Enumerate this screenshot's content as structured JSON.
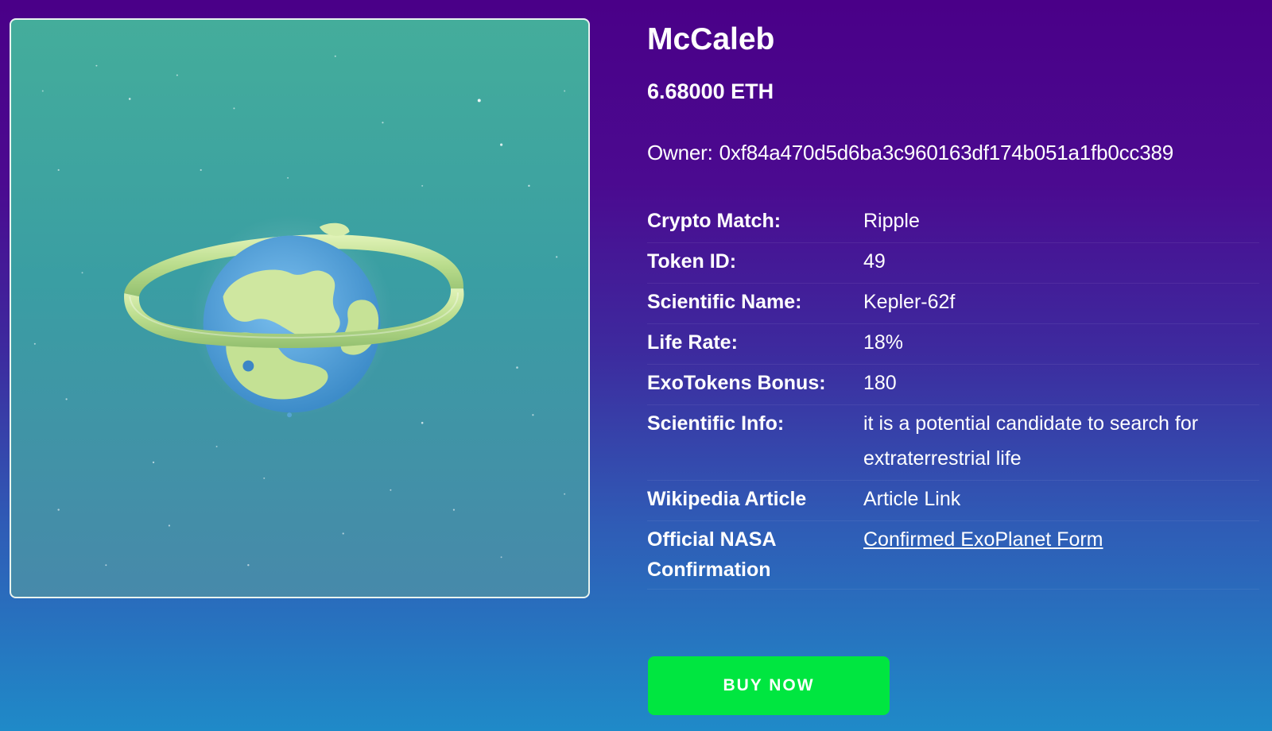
{
  "planet": {
    "name": "McCaleb",
    "price": "6.68000 ETH",
    "owner_label": "Owner:",
    "owner_address": "0xf84a470d5d6ba3c960163df174b051a1fb0cc389"
  },
  "properties": [
    {
      "label": "Crypto Match:",
      "value": "Ripple"
    },
    {
      "label": "Token ID:",
      "value": "49"
    },
    {
      "label": "Scientific Name:",
      "value": "Kepler-62f"
    },
    {
      "label": "Life Rate:",
      "value": "18%"
    },
    {
      "label": "ExoTokens Bonus:",
      "value": "180"
    },
    {
      "label": "Scientific Info:",
      "value": "it is a potential candidate to search for extraterrestrial life"
    },
    {
      "label": "Wikipedia Article",
      "value": "Article Link"
    },
    {
      "label": "Official NASA Confirmation",
      "value": "Confirmed ExoPlanet Form"
    }
  ],
  "actions": {
    "buy_label": "BUY NOW"
  },
  "colors": {
    "background_top": "#4a0088",
    "background_bottom": "#1f8ac8",
    "viewer_bg": "#3fa6a0",
    "buy_button": "#00e640",
    "planet_ocean": "#5aa8e0",
    "planet_land": "#cfe7a0",
    "ring": "#c8e8a0"
  },
  "icons": {
    "viewer": "planet-3d-model"
  }
}
